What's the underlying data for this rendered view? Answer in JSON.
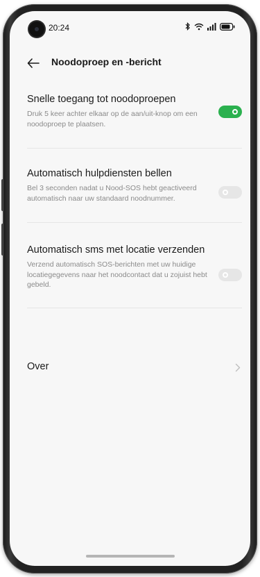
{
  "status_bar": {
    "time": "20:24",
    "icons": [
      "bluetooth-icon",
      "wifi-icon",
      "signal-icon",
      "battery-icon"
    ]
  },
  "header": {
    "back_icon": "arrow-left-icon",
    "title": "Noodoproep en -bericht"
  },
  "settings": [
    {
      "title": "Snelle toegang tot noodoproepen",
      "description": "Druk 5 keer achter elkaar op de aan/uit-knop om een noodoproep te plaatsen.",
      "enabled": true
    },
    {
      "title": "Automatisch hulpdiensten bellen",
      "description": "Bel 3 seconden nadat u Nood-SOS hebt geactiveerd automatisch naar uw standaard noodnummer.",
      "enabled": false
    },
    {
      "title": "Automatisch sms met locatie verzenden",
      "description": "Verzend automatisch SOS-berichten met uw huidige locatiegegevens naar het noodcontact dat u zojuist hebt gebeld.",
      "enabled": false
    }
  ],
  "about": {
    "label": "Over",
    "icon": "chevron-right-icon"
  },
  "colors": {
    "toggle_on": "#2bb14f",
    "toggle_off": "#e6e6e6",
    "background": "#f7f7f7"
  }
}
